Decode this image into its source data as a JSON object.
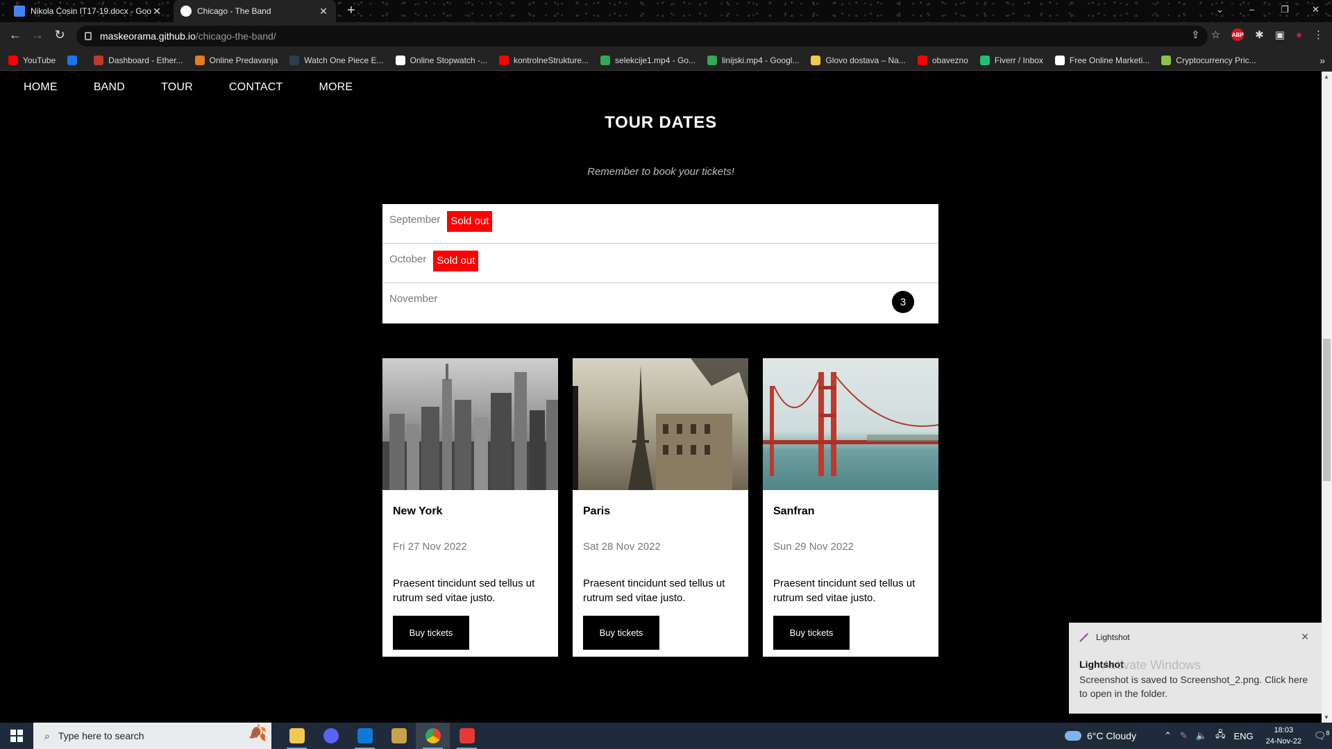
{
  "browser": {
    "tabs": [
      {
        "title": "Nikola Ćosin IT17-19.docx - Goo",
        "active": false
      },
      {
        "title": "Chicago - The Band",
        "active": true
      }
    ],
    "new_tab": "+",
    "window_controls": [
      "⌄",
      "–",
      "❐",
      "✕"
    ],
    "url_host": "maskeorama.github.io",
    "url_path": "/chicago-the-band/",
    "bookmarks": [
      {
        "label": "YouTube",
        "color": "#ff0000"
      },
      {
        "label": "",
        "color": "#1877f2"
      },
      {
        "label": "Dashboard - Ether...",
        "color": "#c0392b"
      },
      {
        "label": "Online Predavanja",
        "color": "#e67e22"
      },
      {
        "label": "Watch One Piece E...",
        "color": "#2c3e50"
      },
      {
        "label": "Online Stopwatch -...",
        "color": "#ffffff"
      },
      {
        "label": "kontrolneStrukture...",
        "color": "#ff0000"
      },
      {
        "label": "selekcije1.mp4 - Go...",
        "color": "#34a853"
      },
      {
        "label": "linijski.mp4 - Googl...",
        "color": "#34a853"
      },
      {
        "label": "Glovo dostava – Na...",
        "color": "#f2c94c"
      },
      {
        "label": "obavezno",
        "color": "#ff0000"
      },
      {
        "label": "Fiverr / Inbox",
        "color": "#1dbf73"
      },
      {
        "label": "Free Online Marketi...",
        "color": "#ffffff"
      },
      {
        "label": "Cryptocurrency Pric...",
        "color": "#8bc34a"
      }
    ]
  },
  "site": {
    "nav": [
      "HOME",
      "BAND",
      "TOUR",
      "CONTACT",
      "MORE"
    ],
    "heading": "TOUR DATES",
    "subheading": "Remember to book your tickets!",
    "months": [
      {
        "name": "September",
        "badge": "Sold out",
        "count": null
      },
      {
        "name": "October",
        "badge": "Sold out",
        "count": null
      },
      {
        "name": "November",
        "badge": null,
        "count": "3"
      }
    ],
    "cards": [
      {
        "city": "New York",
        "date": "Fri 27 Nov 2022",
        "desc": "Praesent tincidunt sed tellus ut rutrum sed vitae justo.",
        "button": "Buy tickets"
      },
      {
        "city": "Paris",
        "date": "Sat 28 Nov 2022",
        "desc": "Praesent tincidunt sed tellus ut rutrum sed vitae justo.",
        "button": "Buy tickets"
      },
      {
        "city": "Sanfran",
        "date": "Sun 29 Nov 2022",
        "desc": "Praesent tincidunt sed tellus ut rutrum sed vitae justo.",
        "button": "Buy tickets"
      }
    ]
  },
  "toast": {
    "app": "Lightshot",
    "title": "Lightshot",
    "message": "Screenshot is saved to Screenshot_2.png. Click here to open in the folder.",
    "close": "✕"
  },
  "watermark": "Activate Windows",
  "taskbar": {
    "search_placeholder": "Type here to search",
    "weather": "6°C  Cloudy",
    "lang": "ENG",
    "time": "18:03",
    "date": "24-Nov-22",
    "notif_count": "8"
  }
}
